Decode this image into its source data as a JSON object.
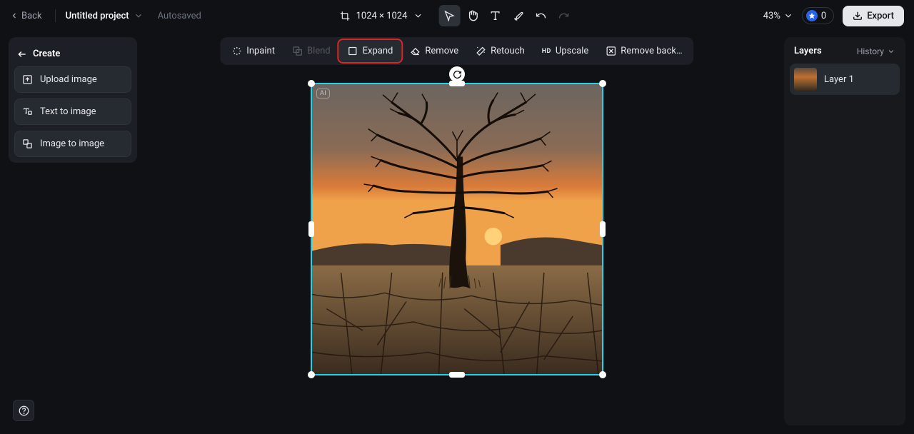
{
  "header": {
    "back": "Back",
    "project_name": "Untitled project",
    "save_state": "Autosaved",
    "dimensions": "1024 × 1024",
    "zoom": "43%",
    "credits": "0",
    "export": "Export"
  },
  "action_bar": {
    "inpaint": "Inpaint",
    "blend": "Blend",
    "expand": "Expand",
    "remove": "Remove",
    "retouch": "Retouch",
    "upscale": "Upscale",
    "remove_bg": "Remove back…"
  },
  "left_panel": {
    "title": "Create",
    "upload": "Upload image",
    "t2i": "Text to image",
    "i2i": "Image to image"
  },
  "right_panel": {
    "title": "Layers",
    "history": "History",
    "layer1": "Layer 1"
  },
  "canvas": {
    "ai_badge": "AI"
  }
}
